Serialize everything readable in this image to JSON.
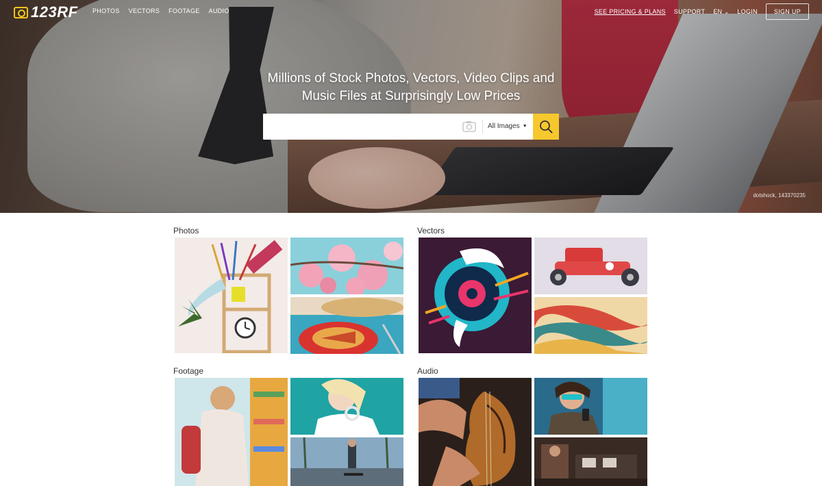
{
  "brand": {
    "name": "123RF"
  },
  "nav": {
    "links": [
      "PHOTOS",
      "VECTORS",
      "FOOTAGE",
      "AUDIO"
    ],
    "pricing": "SEE PRICING & PLANS",
    "support": "SUPPORT",
    "language": "EN",
    "login": "LOGIN",
    "signup": "SIGN UP"
  },
  "hero": {
    "headline_line1": "Millions of Stock Photos, Vectors, Video Clips and",
    "headline_line2": "Music Files at Surprisingly Low Prices",
    "credit": "dotshock, 143370235"
  },
  "search": {
    "value": "",
    "type_label": "All Images",
    "icons": {
      "camera": "camera-icon",
      "go": "search-icon",
      "dropdown": "caret-down-icon"
    }
  },
  "categories": {
    "photos": {
      "title": "Photos"
    },
    "vectors": {
      "title": "Vectors"
    },
    "footage": {
      "title": "Footage"
    },
    "audio": {
      "title": "Audio"
    }
  },
  "colors": {
    "accent": "#f7c82d",
    "text": "#333333",
    "logo_accent": "#f5c518"
  }
}
